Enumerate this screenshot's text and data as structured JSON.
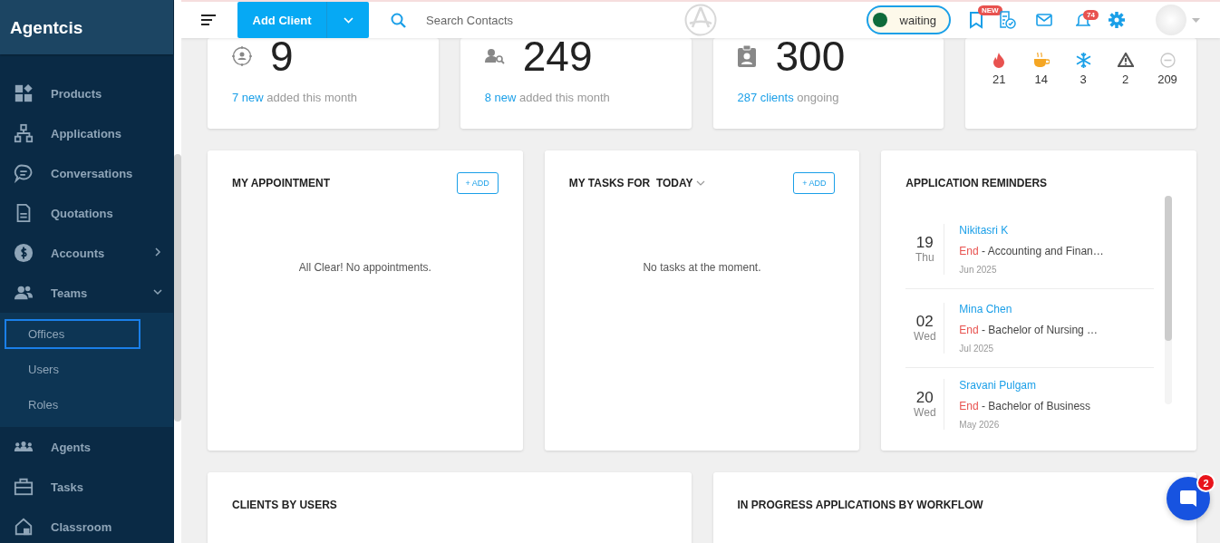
{
  "sidebar": {
    "brand": "Agentcis",
    "items": [
      {
        "label": "Products",
        "selected": false
      },
      {
        "label": "Applications",
        "selected": false
      },
      {
        "label": "Conversations",
        "selected": false
      },
      {
        "label": "Quotations",
        "selected": false
      },
      {
        "label": "Accounts",
        "selected": false,
        "expanded": false
      },
      {
        "label": "Teams",
        "selected": false,
        "expanded": true,
        "children": [
          {
            "label": "Offices",
            "selected": true
          },
          {
            "label": "Users",
            "selected": false
          },
          {
            "label": "Roles",
            "selected": false
          }
        ]
      },
      {
        "label": "Agents",
        "selected": false
      },
      {
        "label": "Tasks",
        "selected": false
      },
      {
        "label": "Classroom",
        "selected": false
      }
    ]
  },
  "top_bar": {
    "add_button": "Add Client",
    "search": {
      "placeholder": "Search Contacts"
    },
    "status": "waiting",
    "badges": {
      "announcements": "NEW",
      "notifications": "74"
    }
  },
  "stats": [
    {
      "value": "9",
      "link": "7 new",
      "note": "added this month"
    },
    {
      "value": "249",
      "link": "8 new",
      "note": "added this month"
    },
    {
      "value": "300",
      "link": "287 clients",
      "note": "ongoing"
    }
  ],
  "lead_ratings": [
    {
      "count": "21",
      "color": "#e8524f"
    },
    {
      "count": "14",
      "color": "#f5a623"
    },
    {
      "count": "3",
      "color": "#1aa0e8"
    },
    {
      "count": "2",
      "color": "#555555"
    },
    {
      "count": "209",
      "color": "#c8c8c8"
    }
  ],
  "appointments": {
    "title": "MY APPOINTMENT",
    "add": "+ ADD",
    "empty": "All Clear! No appointments."
  },
  "tasks": {
    "title": "MY TASKS FOR  TODAY",
    "add": "+ ADD",
    "empty": "No tasks at the moment."
  },
  "reminders": {
    "title": "APPLICATION REMINDERS",
    "items": [
      {
        "day": "19",
        "weekday": "Thu",
        "name": "Nikitasri K",
        "status": "End",
        "course": "- Accounting and Finan…",
        "month": "Jun 2025"
      },
      {
        "day": "02",
        "weekday": "Wed",
        "name": "Mina Chen",
        "status": "End",
        "course": "- Bachelor of Nursing …",
        "month": "Jul 2025"
      },
      {
        "day": "20",
        "weekday": "Wed",
        "name": "Sravani Pulgam",
        "status": "End",
        "course": "- Bachelor of Business",
        "month": "May 2026"
      }
    ]
  },
  "bottom_panels": [
    {
      "title": "CLIENTS BY USERS"
    },
    {
      "title": "IN PROGRESS APPLICATIONS BY WORKFLOW"
    }
  ],
  "chat": {
    "unread": "2"
  }
}
